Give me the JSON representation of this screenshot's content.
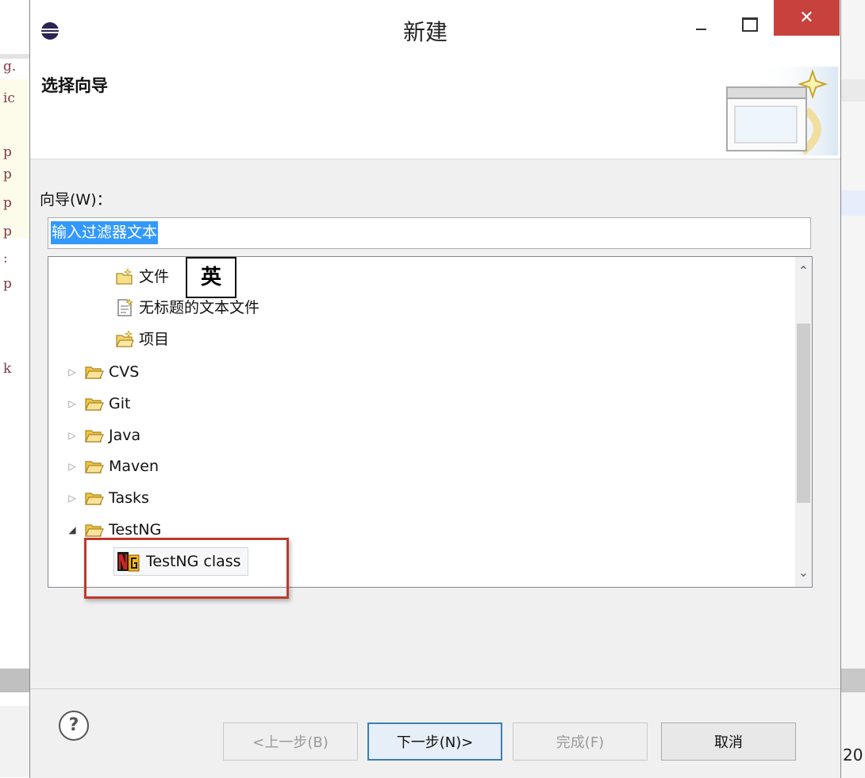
{
  "window": {
    "title": "新建",
    "close_glyph": "✕"
  },
  "header": {
    "title": "选择向导"
  },
  "wizards": {
    "label": "向导(W)：",
    "filter_value": "输入过滤器文本"
  },
  "ime_indicator": "英",
  "tree": {
    "top_items": [
      {
        "label": "文件",
        "icon": "new-file-icon"
      },
      {
        "label": "无标题的文本文件",
        "icon": "text-file-icon"
      },
      {
        "label": "项目",
        "icon": "new-project-icon"
      }
    ],
    "folders": [
      {
        "label": "CVS",
        "expanded": false
      },
      {
        "label": "Git",
        "expanded": false
      },
      {
        "label": "Java",
        "expanded": false
      },
      {
        "label": "Maven",
        "expanded": false
      },
      {
        "label": "Tasks",
        "expanded": false
      },
      {
        "label": "TestNG",
        "expanded": true
      }
    ],
    "selected_child": {
      "label": "TestNG class",
      "icon": "testng-icon"
    }
  },
  "buttons": {
    "back": "<上一步(B)",
    "next": "下一步(N)>",
    "finish": "完成(F)",
    "cancel": "取消",
    "help_glyph": "?"
  },
  "colors": {
    "close_button": "#c7423d",
    "selection": "#3399ff",
    "highlight_box": "#c0392b",
    "folder": "#f0c542"
  },
  "background_fragments": {
    "left": [
      "g.",
      "ic",
      "p",
      "p",
      "p",
      "p",
      ":",
      "p",
      "k"
    ],
    "right_bottom": "20"
  }
}
